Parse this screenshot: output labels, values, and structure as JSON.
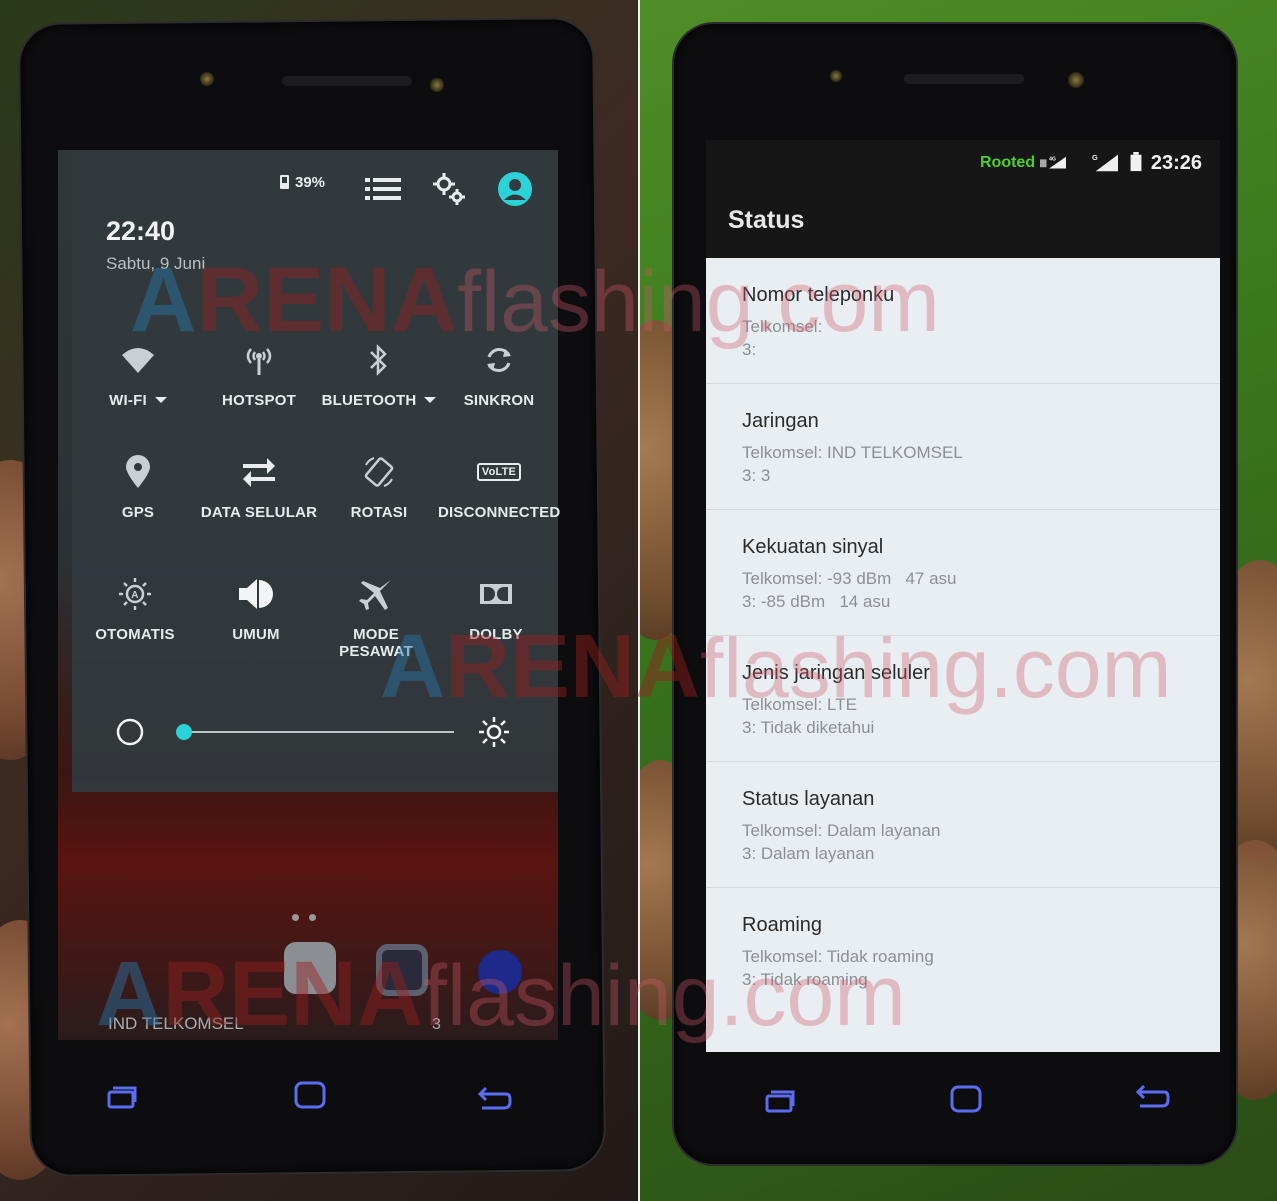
{
  "left_screen": {
    "battery": "39%",
    "clock": "22:40",
    "date": "Sabtu, 9 Juni",
    "tiles": [
      {
        "label": "WI-FI",
        "icon": "wifi-icon",
        "dropdown": true
      },
      {
        "label": "HOTSPOT",
        "icon": "hotspot-icon"
      },
      {
        "label": "BLUETOOTH",
        "icon": "bluetooth-icon",
        "dropdown": true
      },
      {
        "label": "SINKRON",
        "icon": "sync-icon"
      },
      {
        "label": "GPS",
        "icon": "location-icon"
      },
      {
        "label": "DATA SELULAR",
        "icon": "data-arrows-icon"
      },
      {
        "label": "ROTASI",
        "icon": "rotate-icon"
      },
      {
        "label": "DISCONNECTED",
        "icon": "volte-icon",
        "icon_text": "VoLTE"
      },
      {
        "label": "OTOMATIS",
        "icon": "auto-brightness-icon"
      },
      {
        "label": "UMUM",
        "icon": "volume-icon"
      },
      {
        "label": "MODE PESAWAT",
        "icon": "airplane-icon"
      },
      {
        "label": "DOLBY",
        "icon": "dolby-icon"
      }
    ],
    "brightness_level": 0.0,
    "accent_color": "#2bd3d9",
    "carrier": "IND TELKOMSEL",
    "sim2_label": "3"
  },
  "right_screen": {
    "rooted_label": "Rooted",
    "network_badge": "4G",
    "time": "23:26",
    "title": "Status",
    "items": [
      {
        "title": "Nomor teleponku",
        "lines": [
          "Telkomsel:",
          "3:"
        ]
      },
      {
        "title": "Jaringan",
        "lines": [
          "Telkomsel: IND TELKOMSEL",
          "3: 3"
        ]
      },
      {
        "title": "Kekuatan sinyal",
        "lines": [
          "Telkomsel: -93 dBm   47 asu",
          "3: -85 dBm   14 asu"
        ]
      },
      {
        "title": "Jenis jaringan seluler",
        "lines": [
          "Telkomsel: LTE",
          "3: Tidak diketahui"
        ]
      },
      {
        "title": "Status layanan",
        "lines": [
          "Telkomsel: Dalam layanan",
          "3: Dalam layanan"
        ]
      },
      {
        "title": "Roaming",
        "lines": [
          "Telkomsel: Tidak roaming",
          "3: Tidak roaming"
        ]
      }
    ]
  },
  "watermark": {
    "part1": "ARENA",
    "part2": "flashing.com"
  }
}
